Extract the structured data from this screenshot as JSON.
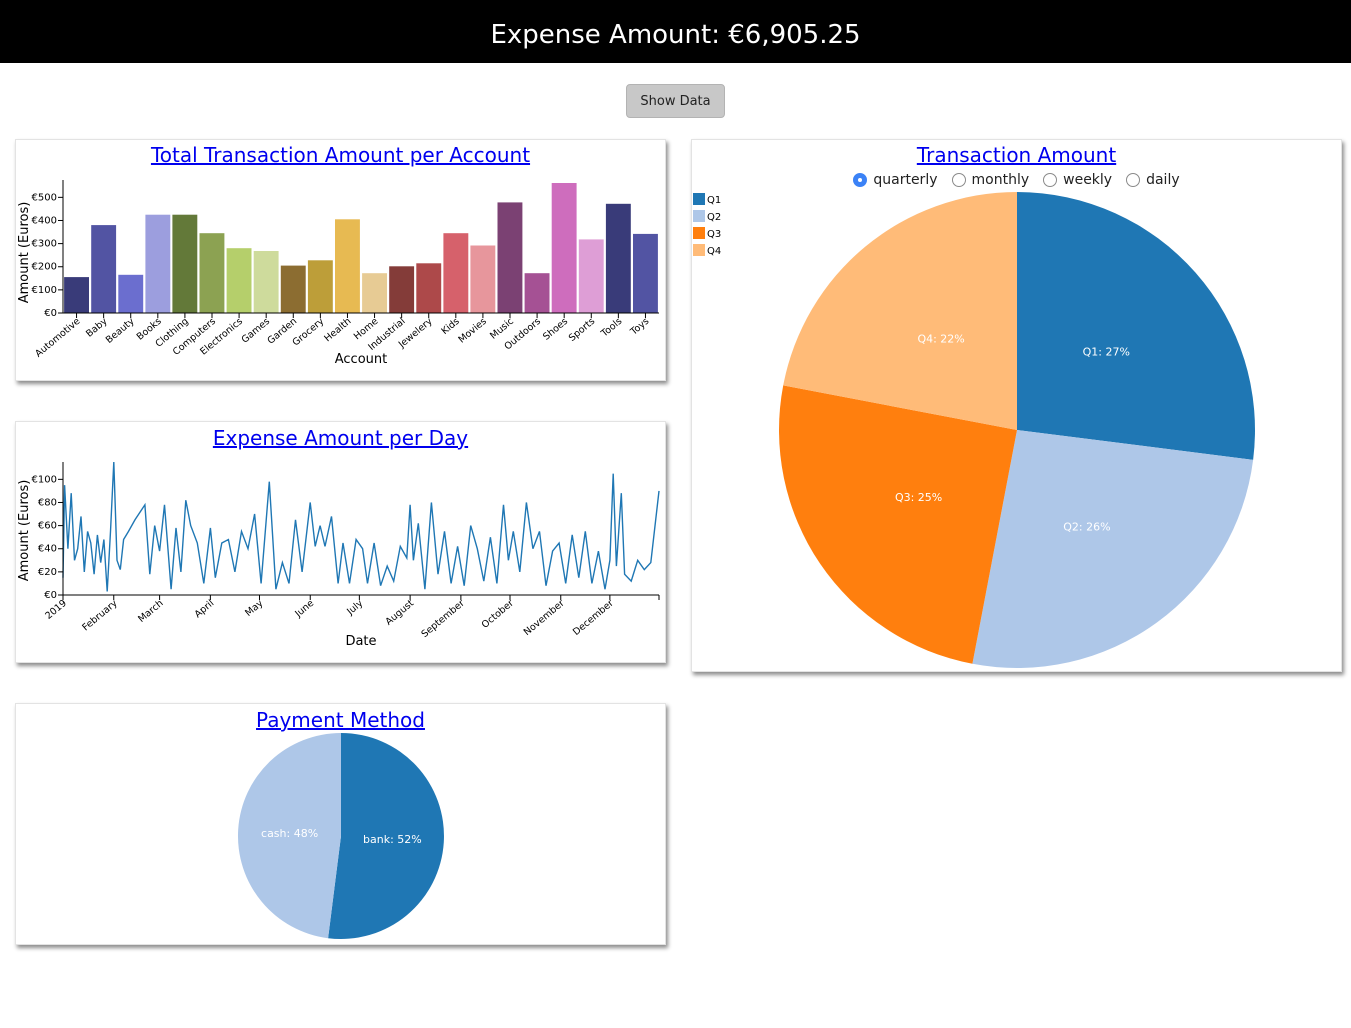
{
  "header": {
    "title": "Expense Amount: €6,905.25"
  },
  "controls": {
    "show_data_label": "Show Data"
  },
  "colors": {
    "header_bg": "#000000",
    "link": "#0000ee",
    "line": "#1f77b4",
    "pie_q": [
      "#1f77b4",
      "#aec7e8",
      "#ff7f0e",
      "#ffbb78"
    ]
  },
  "account_chart": {
    "title": "Total Transaction Amount per Account",
    "chart_data": {
      "type": "bar",
      "title": "Total Transaction Amount per Account",
      "xlabel": "Account",
      "ylabel": "Amount (Euros)",
      "ylim": [
        0,
        575
      ],
      "yticks": [
        0,
        100,
        200,
        300,
        400,
        500
      ],
      "ytick_labels": [
        "€0",
        "€100",
        "€200",
        "€300",
        "€400",
        "€500"
      ],
      "categories": [
        "Automotive",
        "Baby",
        "Beauty",
        "Books",
        "Clothing",
        "Computers",
        "Electronics",
        "Games",
        "Garden",
        "Grocery",
        "Health",
        "Home",
        "Industrial",
        "Jewelery",
        "Kids",
        "Movies",
        "Music",
        "Outdoors",
        "Shoes",
        "Sports",
        "Tools",
        "Toys"
      ],
      "values": [
        155,
        380,
        165,
        425,
        425,
        345,
        280,
        268,
        205,
        228,
        405,
        172,
        202,
        215,
        345,
        292,
        478,
        172,
        562,
        318,
        472,
        342
      ],
      "colors": [
        "#393b79",
        "#5254a3",
        "#6b6ecf",
        "#9c9ede",
        "#637939",
        "#8ca252",
        "#b5cf6b",
        "#cedb9c",
        "#8c6d31",
        "#bd9e39",
        "#e7ba52",
        "#e7cb94",
        "#843c39",
        "#ad494a",
        "#d6616b",
        "#e7969c",
        "#7b4173",
        "#a55194",
        "#ce6dbd",
        "#de9ed6",
        "#393b79",
        "#5254a3"
      ]
    }
  },
  "daily_chart": {
    "title": "Expense Amount per Day",
    "chart_data": {
      "type": "line",
      "title": "Expense Amount per Day",
      "xlabel": "Date",
      "ylabel": "Amount (Euros)",
      "ylim": [
        0,
        115
      ],
      "xlim": [
        "2019-01-01",
        "2019-12-31"
      ],
      "yticks": [
        0,
        20,
        40,
        60,
        80,
        100
      ],
      "ytick_labels": [
        "€0",
        "€20",
        "€40",
        "€60",
        "€80",
        "€100"
      ],
      "month_ticks": [
        {
          "date": "2019-01-01",
          "label": "2019"
        },
        {
          "date": "2019-02-01",
          "label": "February"
        },
        {
          "date": "2019-03-01",
          "label": "March"
        },
        {
          "date": "2019-04-01",
          "label": "April"
        },
        {
          "date": "2019-05-01",
          "label": "May"
        },
        {
          "date": "2019-06-01",
          "label": "June"
        },
        {
          "date": "2019-07-01",
          "label": "July"
        },
        {
          "date": "2019-08-01",
          "label": "August"
        },
        {
          "date": "2019-09-01",
          "label": "September"
        },
        {
          "date": "2019-10-01",
          "label": "October"
        },
        {
          "date": "2019-11-01",
          "label": "November"
        },
        {
          "date": "2019-12-01",
          "label": "December"
        }
      ],
      "points": [
        [
          "2019-01-01",
          15
        ],
        [
          "2019-01-02",
          95
        ],
        [
          "2019-01-04",
          40
        ],
        [
          "2019-01-06",
          88
        ],
        [
          "2019-01-08",
          30
        ],
        [
          "2019-01-10",
          40
        ],
        [
          "2019-01-12",
          68
        ],
        [
          "2019-01-14",
          20
        ],
        [
          "2019-01-16",
          55
        ],
        [
          "2019-01-18",
          45
        ],
        [
          "2019-01-20",
          18
        ],
        [
          "2019-01-22",
          52
        ],
        [
          "2019-01-24",
          28
        ],
        [
          "2019-01-26",
          48
        ],
        [
          "2019-01-28",
          3
        ],
        [
          "2019-01-30",
          55
        ],
        [
          "2019-02-01",
          115
        ],
        [
          "2019-02-03",
          30
        ],
        [
          "2019-02-05",
          22
        ],
        [
          "2019-02-07",
          48
        ],
        [
          "2019-02-10",
          55
        ],
        [
          "2019-02-14",
          65
        ],
        [
          "2019-02-20",
          78
        ],
        [
          "2019-02-23",
          18
        ],
        [
          "2019-02-26",
          60
        ],
        [
          "2019-03-01",
          38
        ],
        [
          "2019-03-04",
          78
        ],
        [
          "2019-03-08",
          5
        ],
        [
          "2019-03-11",
          58
        ],
        [
          "2019-03-14",
          20
        ],
        [
          "2019-03-17",
          82
        ],
        [
          "2019-03-20",
          60
        ],
        [
          "2019-03-24",
          45
        ],
        [
          "2019-03-28",
          10
        ],
        [
          "2019-04-01",
          58
        ],
        [
          "2019-04-04",
          15
        ],
        [
          "2019-04-08",
          45
        ],
        [
          "2019-04-12",
          48
        ],
        [
          "2019-04-16",
          20
        ],
        [
          "2019-04-20",
          55
        ],
        [
          "2019-04-24",
          40
        ],
        [
          "2019-04-28",
          70
        ],
        [
          "2019-05-02",
          10
        ],
        [
          "2019-05-07",
          98
        ],
        [
          "2019-05-11",
          5
        ],
        [
          "2019-05-15",
          28
        ],
        [
          "2019-05-19",
          10
        ],
        [
          "2019-05-23",
          65
        ],
        [
          "2019-05-27",
          20
        ],
        [
          "2019-06-01",
          80
        ],
        [
          "2019-06-04",
          42
        ],
        [
          "2019-06-07",
          60
        ],
        [
          "2019-06-10",
          42
        ],
        [
          "2019-06-14",
          68
        ],
        [
          "2019-06-18",
          10
        ],
        [
          "2019-06-21",
          45
        ],
        [
          "2019-06-25",
          10
        ],
        [
          "2019-06-29",
          48
        ],
        [
          "2019-07-03",
          40
        ],
        [
          "2019-07-06",
          10
        ],
        [
          "2019-07-10",
          45
        ],
        [
          "2019-07-14",
          8
        ],
        [
          "2019-07-18",
          25
        ],
        [
          "2019-07-22",
          12
        ],
        [
          "2019-07-26",
          42
        ],
        [
          "2019-07-30",
          32
        ],
        [
          "2019-08-01",
          78
        ],
        [
          "2019-08-03",
          30
        ],
        [
          "2019-08-06",
          62
        ],
        [
          "2019-08-10",
          5
        ],
        [
          "2019-08-14",
          80
        ],
        [
          "2019-08-18",
          18
        ],
        [
          "2019-08-22",
          55
        ],
        [
          "2019-08-26",
          10
        ],
        [
          "2019-08-30",
          42
        ],
        [
          "2019-09-03",
          8
        ],
        [
          "2019-09-07",
          60
        ],
        [
          "2019-09-11",
          40
        ],
        [
          "2019-09-15",
          12
        ],
        [
          "2019-09-19",
          50
        ],
        [
          "2019-09-23",
          10
        ],
        [
          "2019-09-27",
          78
        ],
        [
          "2019-09-30",
          30
        ],
        [
          "2019-10-03",
          55
        ],
        [
          "2019-10-07",
          20
        ],
        [
          "2019-10-11",
          80
        ],
        [
          "2019-10-15",
          40
        ],
        [
          "2019-10-19",
          55
        ],
        [
          "2019-10-23",
          8
        ],
        [
          "2019-10-27",
          38
        ],
        [
          "2019-10-31",
          45
        ],
        [
          "2019-11-04",
          10
        ],
        [
          "2019-11-08",
          52
        ],
        [
          "2019-11-12",
          15
        ],
        [
          "2019-11-16",
          55
        ],
        [
          "2019-11-20",
          10
        ],
        [
          "2019-11-24",
          38
        ],
        [
          "2019-11-28",
          5
        ],
        [
          "2019-12-01",
          30
        ],
        [
          "2019-12-03",
          105
        ],
        [
          "2019-12-05",
          25
        ],
        [
          "2019-12-08",
          88
        ],
        [
          "2019-12-10",
          18
        ],
        [
          "2019-12-14",
          12
        ],
        [
          "2019-12-18",
          30
        ],
        [
          "2019-12-22",
          22
        ],
        [
          "2019-12-26",
          28
        ],
        [
          "2019-12-31",
          90
        ]
      ]
    }
  },
  "payment_chart": {
    "title": "Payment Method",
    "chart_data": {
      "type": "pie",
      "title": "Payment Method",
      "slices": [
        {
          "label": "bank",
          "value": 52,
          "text": "bank: 52%",
          "color": "#1f77b4"
        },
        {
          "label": "cash",
          "value": 48,
          "text": "cash: 48%",
          "color": "#aec7e8"
        }
      ]
    }
  },
  "transaction_chart": {
    "title": "Transaction Amount",
    "modes": [
      {
        "label": "quarterly",
        "selected": true
      },
      {
        "label": "monthly",
        "selected": false
      },
      {
        "label": "weekly",
        "selected": false
      },
      {
        "label": "daily",
        "selected": false
      }
    ],
    "chart_data": {
      "type": "pie",
      "title": "Transaction Amount",
      "legend": [
        "Q1",
        "Q2",
        "Q3",
        "Q4"
      ],
      "legend_position": "top-left",
      "slices": [
        {
          "label": "Q1",
          "value": 27,
          "text": "Q1: 27%",
          "color": "#1f77b4"
        },
        {
          "label": "Q2",
          "value": 26,
          "text": "Q2: 26%",
          "color": "#aec7e8"
        },
        {
          "label": "Q3",
          "value": 25,
          "text": "Q3: 25%",
          "color": "#ff7f0e"
        },
        {
          "label": "Q4",
          "value": 22,
          "text": "Q4: 22%",
          "color": "#ffbb78"
        }
      ]
    }
  }
}
